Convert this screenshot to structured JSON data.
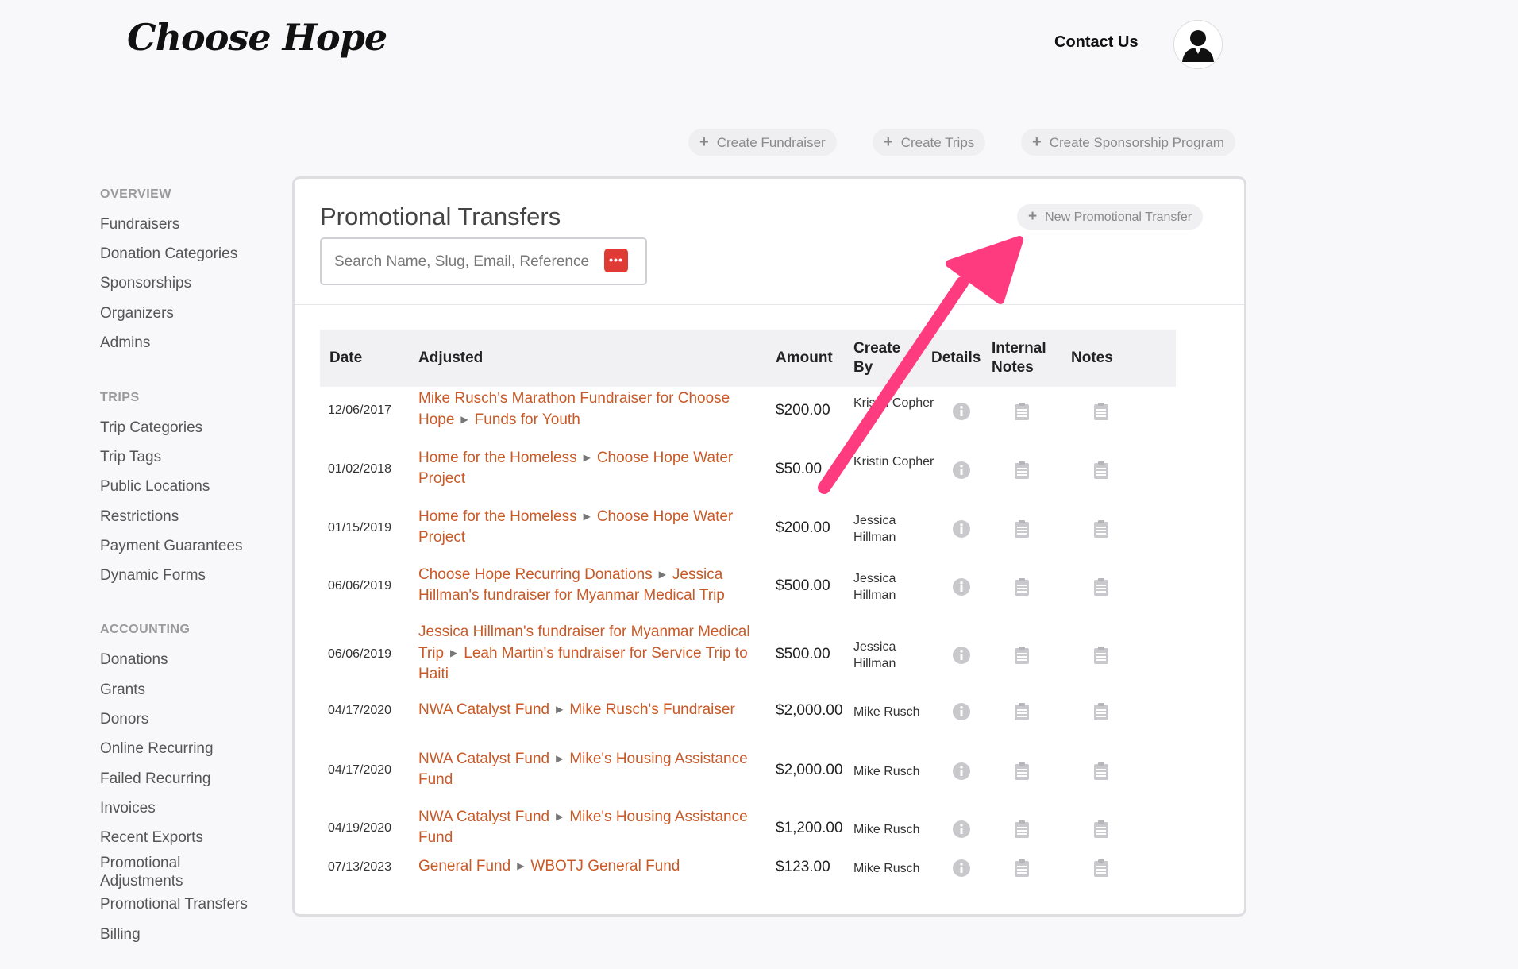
{
  "brand": {
    "logo_text": "Choose Hope"
  },
  "header": {
    "contact": "Contact Us"
  },
  "top_actions": [
    {
      "label": "Create Fundraiser"
    },
    {
      "label": "Create Trips"
    },
    {
      "label": "Create Sponsorship Program"
    }
  ],
  "sidebar": {
    "sections": [
      {
        "title": "OVERVIEW",
        "items": [
          "Fundraisers",
          "Donation Categories",
          "Sponsorships",
          "Organizers",
          "Admins"
        ]
      },
      {
        "title": "TRIPS",
        "items": [
          "Trip Categories",
          "Trip Tags",
          "Public Locations",
          "Restrictions",
          "Payment Guarantees",
          "Dynamic Forms"
        ]
      },
      {
        "title": "ACCOUNTING",
        "items": [
          "Donations",
          "Grants",
          "Donors",
          "Online Recurring",
          "Failed Recurring",
          "Invoices",
          "Recent Exports",
          "Promotional Adjustments",
          "Promotional Transfers",
          "Billing"
        ]
      }
    ]
  },
  "main": {
    "title": "Promotional Transfers",
    "new_button": "New Promotional Transfer",
    "search_placeholder": "Search Name, Slug, Email, Reference",
    "columns": [
      "Date",
      "Adjusted",
      "Amount",
      "Create By",
      "Details",
      "Internal Notes",
      "Notes"
    ],
    "rows": [
      {
        "date": "12/06/2017",
        "from": "Mike Rusch's Marathon Fundraiser for Choose Hope",
        "to": "Funds for Youth",
        "amount": "$200.00",
        "by": "Kristin Copher"
      },
      {
        "date": "01/02/2018",
        "from": "Home for the Homeless",
        "to": "Choose Hope Water Project",
        "amount": "$50.00",
        "by": "Kristin Copher"
      },
      {
        "date": "01/15/2019",
        "from": "Home for the Homeless",
        "to": "Choose Hope Water Project",
        "amount": "$200.00",
        "by": "Jessica Hillman"
      },
      {
        "date": "06/06/2019",
        "from": "Choose Hope Recurring Donations",
        "to": "Jessica Hillman's fundraiser for Myanmar Medical Trip",
        "amount": "$500.00",
        "by": "Jessica Hillman"
      },
      {
        "date": "06/06/2019",
        "from": "Jessica Hillman's fundraiser for Myanmar Medical Trip",
        "to": "Leah Martin's fundraiser for Service Trip to Haiti",
        "amount": "$500.00",
        "by": "Jessica Hillman"
      },
      {
        "date": "04/17/2020",
        "from": "NWA Catalyst Fund",
        "to": "Mike Rusch's Fundraiser",
        "amount": "$2,000.00",
        "by": "Mike Rusch"
      },
      {
        "date": "04/17/2020",
        "from": "NWA Catalyst Fund",
        "to": "Mike's Housing Assistance Fund",
        "amount": "$2,000.00",
        "by": "Mike Rusch"
      },
      {
        "date": "04/19/2020",
        "from": "NWA Catalyst Fund",
        "to": "Mike's Housing Assistance Fund",
        "amount": "$1,200.00",
        "by": "Mike Rusch"
      },
      {
        "date": "07/13/2023",
        "from": "General Fund",
        "to": "WBOTJ General Fund",
        "amount": "$123.00",
        "by": "Mike Rusch"
      }
    ]
  },
  "icons": {
    "details": "info-icon",
    "internal_notes": "notepad-icon",
    "notes": "notepad-icon",
    "search_badge": "password-manager-icon",
    "avatar": "user-icon"
  },
  "colors": {
    "link": "#c85a28",
    "annotation_arrow": "#ff3b7f",
    "search_badge": "#e03a35"
  }
}
